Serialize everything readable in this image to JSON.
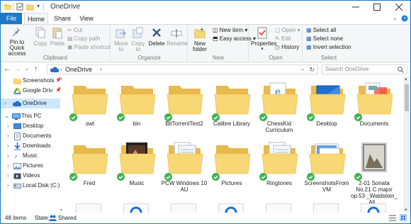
{
  "window": {
    "title": "OneDrive"
  },
  "tabs": [
    {
      "label": "File"
    },
    {
      "label": "Home"
    },
    {
      "label": "Share"
    },
    {
      "label": "View"
    }
  ],
  "ribbon": {
    "pin_label": "Pin to Quick access",
    "copy_label": "Copy",
    "paste_label": "Paste",
    "cut_label": "Cut",
    "copy_path_label": "Copy path",
    "paste_shortcut_label": "Paste shortcut",
    "clipboard_group": "Clipboard",
    "move_to_label": "Move to",
    "copy_to_label": "Copy to",
    "delete_label": "Delete",
    "rename_label": "Rename",
    "organize_group": "Organize",
    "new_folder_label": "New folder",
    "new_item_label": "New item",
    "easy_access_label": "Easy access",
    "new_group": "New",
    "properties_label": "Properties",
    "open_label": "Open",
    "edit_label": "Edit",
    "history_label": "History",
    "open_group": "Open",
    "select_all_label": "Select all",
    "select_none_label": "Select none",
    "invert_selection_label": "Invert selection",
    "select_group": "Select"
  },
  "address": {
    "path": "OneDrive",
    "search_placeholder": "Search OneDrive"
  },
  "nav": {
    "items": [
      {
        "label": "Screenshots"
      },
      {
        "label": "Google Driv"
      },
      {
        "label": "OneDrive"
      },
      {
        "label": "This PC"
      },
      {
        "label": "Desktop"
      },
      {
        "label": "Documents"
      },
      {
        "label": "Downloads"
      },
      {
        "label": "Music"
      },
      {
        "label": "Pictures"
      },
      {
        "label": "Videos"
      },
      {
        "label": "Local Disk (C:)"
      }
    ]
  },
  "files": [
    {
      "label": ".swt",
      "kind": "folder"
    },
    {
      "label": "bin",
      "kind": "folder"
    },
    {
      "label": "BitTorrentTest2",
      "kind": "folder"
    },
    {
      "label": "Calibre Library",
      "kind": "folder"
    },
    {
      "label": "ChessKid Curriculum",
      "kind": "folder-doc"
    },
    {
      "label": "Desktop",
      "kind": "folder-desktop"
    },
    {
      "label": "Documents",
      "kind": "folder-docs"
    },
    {
      "label": "Fred",
      "kind": "folder"
    },
    {
      "label": "Music",
      "kind": "folder-music"
    },
    {
      "label": "PCW Windows 10 AU",
      "kind": "folder-paper"
    },
    {
      "label": "Pictures",
      "kind": "folder"
    },
    {
      "label": "Ringtones",
      "kind": "folder-paper"
    },
    {
      "label": "ScreenshotsFrom VM",
      "kind": "folder-shots"
    },
    {
      "label": "2-01 Sonata No.21 C major op.53 _Waldstein_ All...",
      "kind": "audio"
    }
  ],
  "status": {
    "count": "48 items",
    "state_label": "State:",
    "state_value": "Shared"
  },
  "colors": {
    "accent": "#1979ca",
    "folder": "#f8d775",
    "folder_dark": "#e8b94c",
    "check": "#3eb34f",
    "nav_selected": "#cce8ff"
  }
}
